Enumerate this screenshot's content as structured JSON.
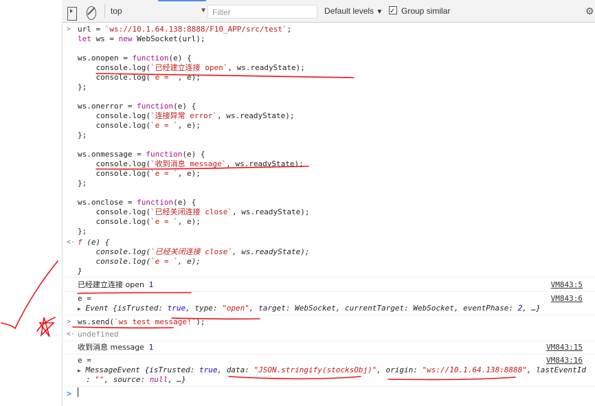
{
  "toolbar": {
    "context": "top",
    "filter_placeholder": "Filter",
    "levels": "Default levels",
    "group_similar": "Group similar"
  },
  "code": [
    {
      "t": "url = `ws://10.1.64.138:8888/F10_APP/src/test`;"
    },
    {
      "t": "let ws = new WebSocket(url);"
    },
    {
      "t": ""
    },
    {
      "t": "ws.onopen = function(e) {"
    },
    {
      "t": "    console.log(`已经建立连接 open`, ws.readyState);"
    },
    {
      "t": "    console.log(`e = `, e);"
    },
    {
      "t": "};"
    },
    {
      "t": ""
    },
    {
      "t": "ws.onerror = function(e) {"
    },
    {
      "t": "    console.log(`连接异常 error`, ws.readyState);"
    },
    {
      "t": "    console.log(`e = `, e);"
    },
    {
      "t": "};"
    },
    {
      "t": ""
    },
    {
      "t": "ws.onmessage = function(e) {"
    },
    {
      "t": "    console.log(`收到消息 message`, ws.readyState);"
    },
    {
      "t": "    console.log(`e = `, e);"
    },
    {
      "t": "};"
    },
    {
      "t": ""
    },
    {
      "t": "ws.onclose = function(e) {"
    },
    {
      "t": "    console.log(`已经关闭连接 close`, ws.readyState);"
    },
    {
      "t": "    console.log(`e = `, e);"
    },
    {
      "t": "};"
    }
  ],
  "result_fn": [
    "f (e) {",
    "    console.log(`已经关闭连接 close`, ws.readyState);",
    "    console.log(`e = `, e);",
    "}"
  ],
  "log1": {
    "text": "已经建立连接 open",
    "value": "1",
    "source": "VM843:5"
  },
  "log2": {
    "text": "e =",
    "source": "VM843:6",
    "obj": "Event {isTrusted: true, type: \"open\", target: WebSocket, currentTarget: WebSocket, eventPhase: 2, …}"
  },
  "cmd2": "ws.send(`ws test message!`);",
  "undef": "undefined",
  "log3": {
    "text": "收到消息 message",
    "value": "1",
    "source": "VM843:15"
  },
  "log4": {
    "text": "e =",
    "source": "VM843:16",
    "obj1": "MessageEvent {isTrusted: true, data: \"JSON.stringify(stocksObj)\", origin: \"ws://10.1.64.138:8888\", lastEventId",
    "obj2": ": \"\", source: null, …}"
  }
}
